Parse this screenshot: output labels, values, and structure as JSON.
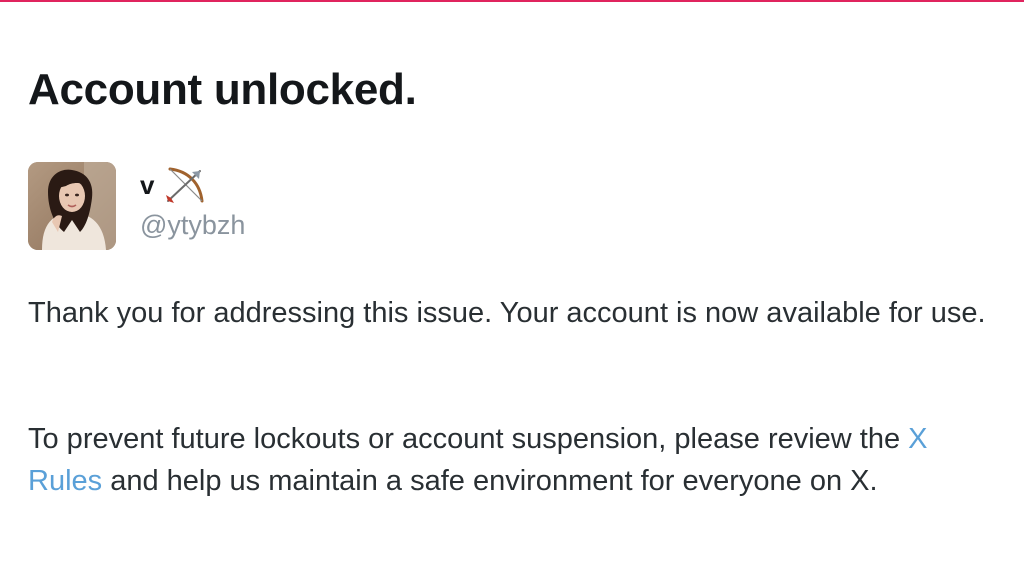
{
  "page": {
    "title": "Account unlocked."
  },
  "profile": {
    "display_name": "v",
    "name_emoji": "bow-and-arrow-emoji",
    "handle": "@ytybzh"
  },
  "message": {
    "paragraph1": "Thank you for addressing this issue. Your account is now available for use.",
    "paragraph2_before_link": "To prevent future lockouts or account suspension, please review the ",
    "rules_link": "X Rules",
    "paragraph2_after_link": " and help us maintain a safe environment for everyone on X."
  },
  "colors": {
    "accent_rule": "#e0245e",
    "link": "#5aa0d8",
    "handle_gray": "#8a949e",
    "text": "#14171a"
  }
}
